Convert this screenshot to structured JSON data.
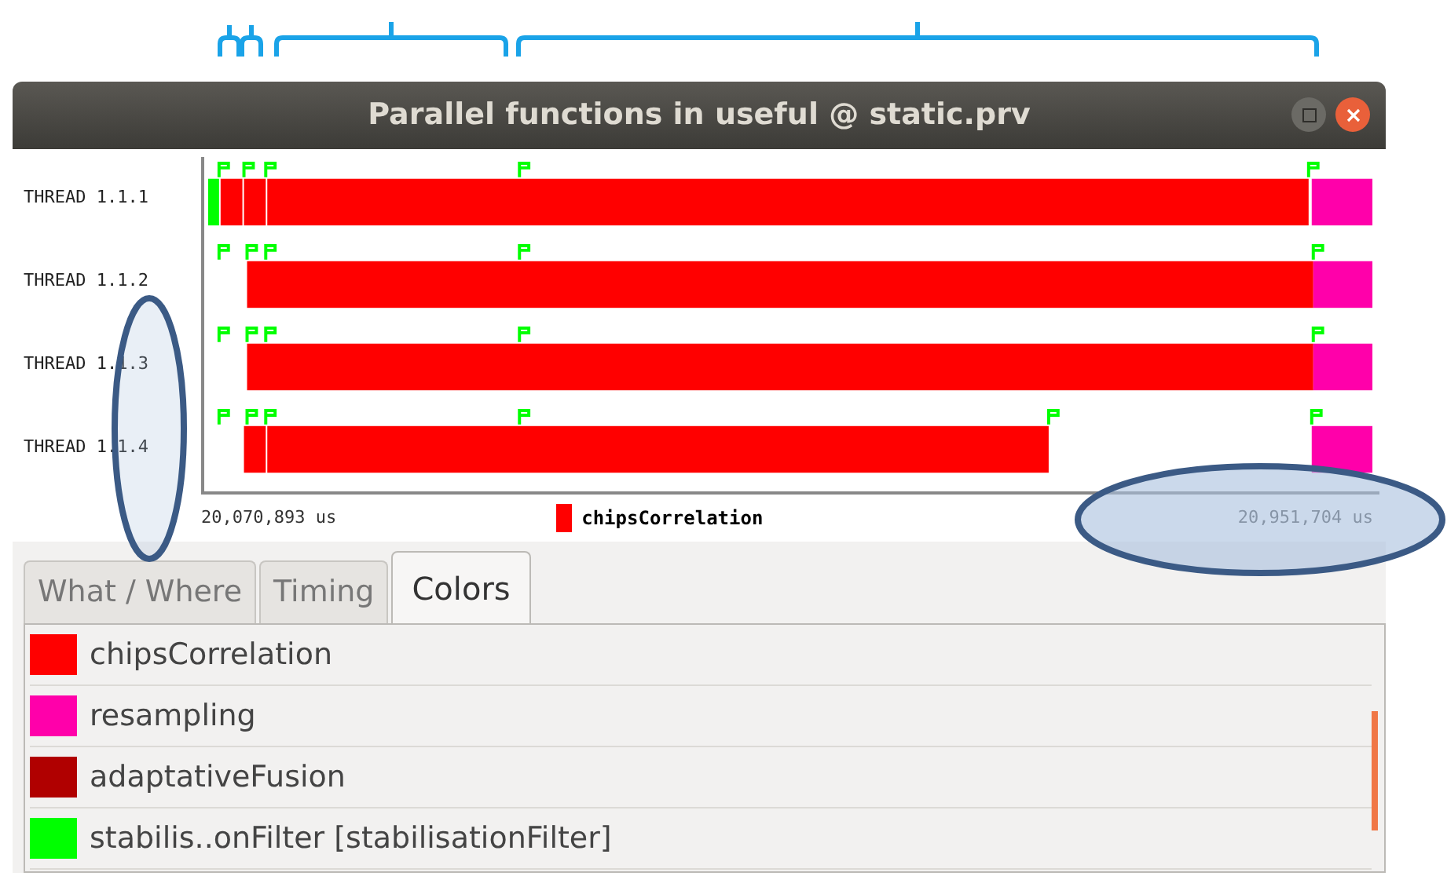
{
  "window": {
    "title": "Parallel functions in useful @ static.prv"
  },
  "threads": [
    {
      "label": "THREAD 1.1.1"
    },
    {
      "label": "THREAD 1.1.2"
    },
    {
      "label": "THREAD 1.1.3"
    },
    {
      "label": "THREAD 1.1.4"
    }
  ],
  "axis": {
    "start": "20,070,893 us",
    "end": "20,951,704 us"
  },
  "legend": {
    "label": "chipsCorrelation",
    "color": "#ff0000"
  },
  "tabs": [
    {
      "label": "What / Where",
      "selected": false
    },
    {
      "label": "Timing",
      "selected": false
    },
    {
      "label": "Colors",
      "selected": true
    }
  ],
  "colors": [
    {
      "label": "chipsCorrelation",
      "color": "#ff0000"
    },
    {
      "label": "resampling",
      "color": "#ff00aa"
    },
    {
      "label": "adaptativeFusion",
      "color": "#b00000"
    },
    {
      "label": "stabilis..onFilter [stabilisationFilter]",
      "color": "#00ff00"
    }
  ]
}
